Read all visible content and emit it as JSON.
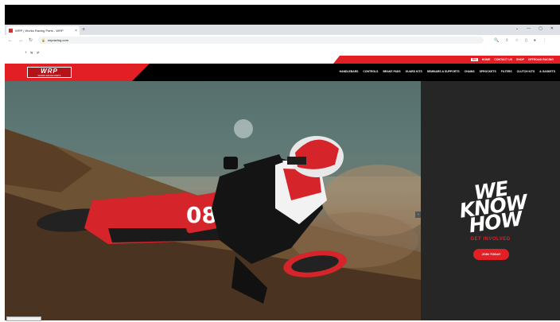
{
  "browser": {
    "tab_title": "WRP | Works Racing Parts - WRP",
    "tab_close": "×",
    "new_tab": "+",
    "url": "wrpracing.com",
    "window_controls": [
      "⌄",
      "—",
      "▢",
      "✕"
    ]
  },
  "site": {
    "utility_left": [
      "f",
      "ig",
      "yt"
    ],
    "utility_right": [
      "EN",
      "HOME",
      "CONTACT US",
      "SHOP",
      "OFFROAD RACING"
    ],
    "logo_main": "WRP",
    "logo_sub": "WORKS RACING PARTS",
    "nav": [
      "HANDLEBARS",
      "CONTROLS",
      "BRAKE PADS",
      "GUARD KITS",
      "SEMINARS & SUPPORTS",
      "CHAINS",
      "SPROCKETS",
      "FILTERS",
      "CLUTCH KITS",
      "& GASKETS"
    ],
    "hero": {
      "tagline_lines": [
        "WE",
        "KNOW",
        "HOW"
      ],
      "sub": "GET INVOLVED",
      "cta": "JOIN TODAY",
      "bike_number": "08",
      "slide_arrow": "‹"
    }
  },
  "colors": {
    "brand_red": "#e31f26",
    "dark_panel": "#262626"
  }
}
